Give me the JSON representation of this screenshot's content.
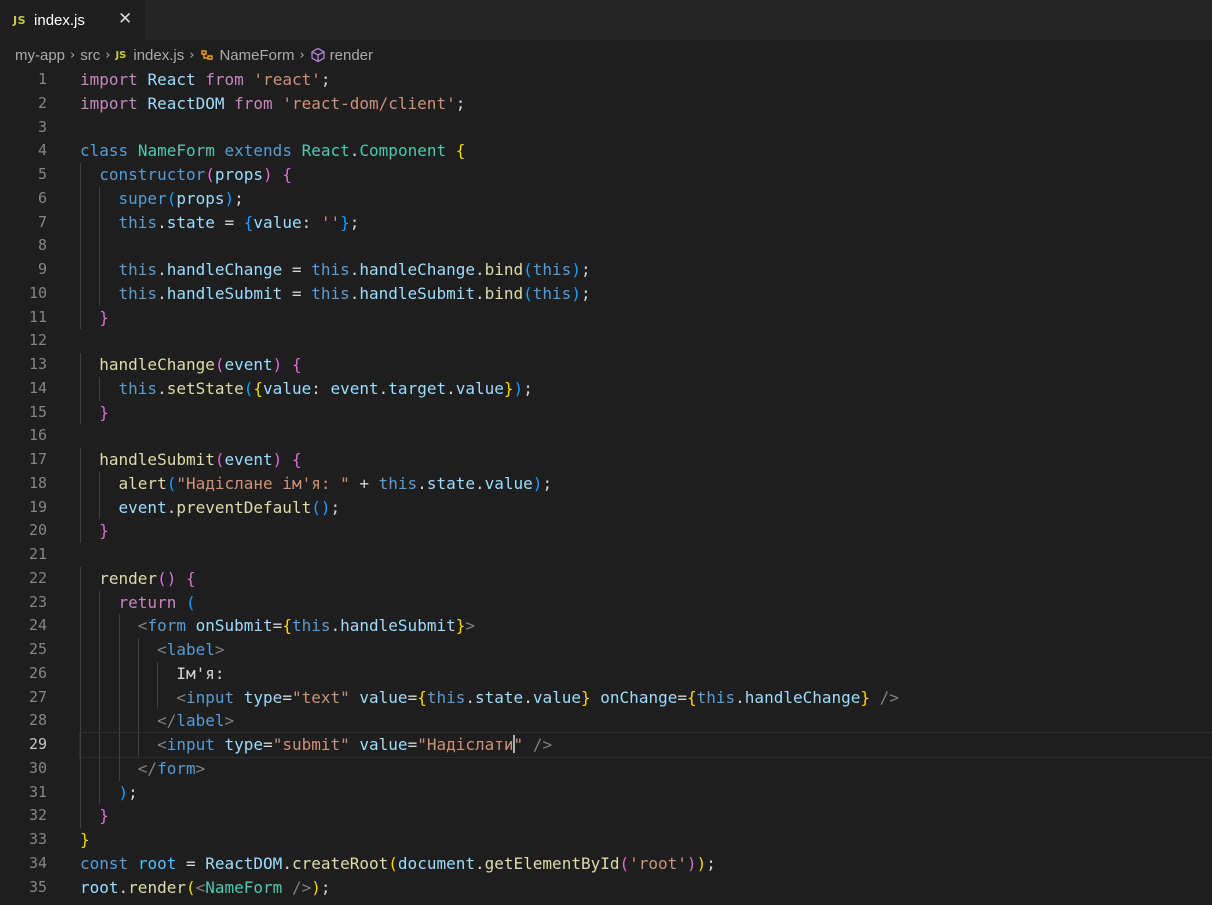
{
  "tab": {
    "badge": "JS",
    "title": "index.js",
    "close": "✕"
  },
  "breadcrumb": {
    "items": [
      "my-app",
      "src",
      "index.js",
      "NameForm",
      "render"
    ],
    "js_badge": "JS"
  },
  "editor": {
    "language": "javascript",
    "current_line": 29,
    "line_numbers": [
      "1",
      "2",
      "3",
      "4",
      "5",
      "6",
      "7",
      "8",
      "9",
      "10",
      "11",
      "12",
      "13",
      "14",
      "15",
      "16",
      "17",
      "18",
      "19",
      "20",
      "21",
      "22",
      "23",
      "24",
      "25",
      "26",
      "27",
      "28",
      "29",
      "30",
      "31",
      "32",
      "33",
      "34",
      "35"
    ],
    "lines": [
      [
        [
          "kc",
          "import"
        ],
        [
          "pl",
          " "
        ],
        [
          "var",
          "React"
        ],
        [
          "pl",
          " "
        ],
        [
          "kc",
          "from"
        ],
        [
          "pl",
          " "
        ],
        [
          "str",
          "'react'"
        ],
        [
          "pl",
          ";"
        ]
      ],
      [
        [
          "kc",
          "import"
        ],
        [
          "pl",
          " "
        ],
        [
          "var",
          "ReactDOM"
        ],
        [
          "pl",
          " "
        ],
        [
          "kc",
          "from"
        ],
        [
          "pl",
          " "
        ],
        [
          "str",
          "'react-dom/client'"
        ],
        [
          "pl",
          ";"
        ]
      ],
      [],
      [
        [
          "kw",
          "class"
        ],
        [
          "pl",
          " "
        ],
        [
          "cls",
          "NameForm"
        ],
        [
          "pl",
          " "
        ],
        [
          "kw",
          "extends"
        ],
        [
          "pl",
          " "
        ],
        [
          "cls",
          "React"
        ],
        [
          "pl",
          "."
        ],
        [
          "cls",
          "Component"
        ],
        [
          "pl",
          " "
        ],
        [
          "b1",
          "{"
        ]
      ],
      [
        [
          "pl",
          "  "
        ],
        [
          "kw",
          "constructor"
        ],
        [
          "b2",
          "("
        ],
        [
          "var",
          "props"
        ],
        [
          "b2",
          ")"
        ],
        [
          "pl",
          " "
        ],
        [
          "b2",
          "{"
        ]
      ],
      [
        [
          "pl",
          "    "
        ],
        [
          "kw",
          "super"
        ],
        [
          "b3",
          "("
        ],
        [
          "var",
          "props"
        ],
        [
          "b3",
          ")"
        ],
        [
          "pl",
          ";"
        ]
      ],
      [
        [
          "pl",
          "    "
        ],
        [
          "kw",
          "this"
        ],
        [
          "pl",
          "."
        ],
        [
          "var",
          "state"
        ],
        [
          "pl",
          " = "
        ],
        [
          "b3",
          "{"
        ],
        [
          "var",
          "value"
        ],
        [
          "pl",
          ": "
        ],
        [
          "str",
          "''"
        ],
        [
          "b3",
          "}"
        ],
        [
          "pl",
          ";"
        ]
      ],
      [],
      [
        [
          "pl",
          "    "
        ],
        [
          "kw",
          "this"
        ],
        [
          "pl",
          "."
        ],
        [
          "var",
          "handleChange"
        ],
        [
          "pl",
          " = "
        ],
        [
          "kw",
          "this"
        ],
        [
          "pl",
          "."
        ],
        [
          "var",
          "handleChange"
        ],
        [
          "pl",
          "."
        ],
        [
          "fn",
          "bind"
        ],
        [
          "b3",
          "("
        ],
        [
          "kw",
          "this"
        ],
        [
          "b3",
          ")"
        ],
        [
          "pl",
          ";"
        ]
      ],
      [
        [
          "pl",
          "    "
        ],
        [
          "kw",
          "this"
        ],
        [
          "pl",
          "."
        ],
        [
          "var",
          "handleSubmit"
        ],
        [
          "pl",
          " = "
        ],
        [
          "kw",
          "this"
        ],
        [
          "pl",
          "."
        ],
        [
          "var",
          "handleSubmit"
        ],
        [
          "pl",
          "."
        ],
        [
          "fn",
          "bind"
        ],
        [
          "b3",
          "("
        ],
        [
          "kw",
          "this"
        ],
        [
          "b3",
          ")"
        ],
        [
          "pl",
          ";"
        ]
      ],
      [
        [
          "pl",
          "  "
        ],
        [
          "b2",
          "}"
        ]
      ],
      [],
      [
        [
          "pl",
          "  "
        ],
        [
          "fn",
          "handleChange"
        ],
        [
          "b2",
          "("
        ],
        [
          "var",
          "event"
        ],
        [
          "b2",
          ")"
        ],
        [
          "pl",
          " "
        ],
        [
          "b2",
          "{"
        ]
      ],
      [
        [
          "pl",
          "    "
        ],
        [
          "kw",
          "this"
        ],
        [
          "pl",
          "."
        ],
        [
          "fn",
          "setState"
        ],
        [
          "b3",
          "("
        ],
        [
          "b1",
          "{"
        ],
        [
          "var",
          "value"
        ],
        [
          "pl",
          ": "
        ],
        [
          "var",
          "event"
        ],
        [
          "pl",
          "."
        ],
        [
          "var",
          "target"
        ],
        [
          "pl",
          "."
        ],
        [
          "var",
          "value"
        ],
        [
          "b1",
          "}"
        ],
        [
          "b3",
          ")"
        ],
        [
          "pl",
          ";"
        ]
      ],
      [
        [
          "pl",
          "  "
        ],
        [
          "b2",
          "}"
        ]
      ],
      [],
      [
        [
          "pl",
          "  "
        ],
        [
          "fn",
          "handleSubmit"
        ],
        [
          "b2",
          "("
        ],
        [
          "var",
          "event"
        ],
        [
          "b2",
          ")"
        ],
        [
          "pl",
          " "
        ],
        [
          "b2",
          "{"
        ]
      ],
      [
        [
          "pl",
          "    "
        ],
        [
          "fn",
          "alert"
        ],
        [
          "b3",
          "("
        ],
        [
          "str",
          "\"Надіслане ім'я: \""
        ],
        [
          "pl",
          " + "
        ],
        [
          "kw",
          "this"
        ],
        [
          "pl",
          "."
        ],
        [
          "var",
          "state"
        ],
        [
          "pl",
          "."
        ],
        [
          "var",
          "value"
        ],
        [
          "b3",
          ")"
        ],
        [
          "pl",
          ";"
        ]
      ],
      [
        [
          "pl",
          "    "
        ],
        [
          "var",
          "event"
        ],
        [
          "pl",
          "."
        ],
        [
          "fn",
          "preventDefault"
        ],
        [
          "b3",
          "("
        ],
        [
          "b3",
          ")"
        ],
        [
          "pl",
          ";"
        ]
      ],
      [
        [
          "pl",
          "  "
        ],
        [
          "b2",
          "}"
        ]
      ],
      [],
      [
        [
          "pl",
          "  "
        ],
        [
          "fn",
          "render"
        ],
        [
          "b2",
          "("
        ],
        [
          "b2",
          ")"
        ],
        [
          "pl",
          " "
        ],
        [
          "b2",
          "{"
        ]
      ],
      [
        [
          "pl",
          "    "
        ],
        [
          "kc",
          "return"
        ],
        [
          "pl",
          " "
        ],
        [
          "b3",
          "("
        ]
      ],
      [
        [
          "pl",
          "      "
        ],
        [
          "tb",
          "<"
        ],
        [
          "tag",
          "form"
        ],
        [
          "pl",
          " "
        ],
        [
          "var",
          "onSubmit"
        ],
        [
          "pl",
          "="
        ],
        [
          "b1",
          "{"
        ],
        [
          "kw",
          "this"
        ],
        [
          "pl",
          "."
        ],
        [
          "var",
          "handleSubmit"
        ],
        [
          "b1",
          "}"
        ],
        [
          "tb",
          ">"
        ]
      ],
      [
        [
          "pl",
          "        "
        ],
        [
          "tb",
          "<"
        ],
        [
          "tag",
          "label"
        ],
        [
          "tb",
          ">"
        ]
      ],
      [
        [
          "pl",
          "          Ім'я:"
        ]
      ],
      [
        [
          "pl",
          "          "
        ],
        [
          "tb",
          "<"
        ],
        [
          "tag",
          "input"
        ],
        [
          "pl",
          " "
        ],
        [
          "var",
          "type"
        ],
        [
          "pl",
          "="
        ],
        [
          "str",
          "\"text\""
        ],
        [
          "pl",
          " "
        ],
        [
          "var",
          "value"
        ],
        [
          "pl",
          "="
        ],
        [
          "b1",
          "{"
        ],
        [
          "kw",
          "this"
        ],
        [
          "pl",
          "."
        ],
        [
          "var",
          "state"
        ],
        [
          "pl",
          "."
        ],
        [
          "var",
          "value"
        ],
        [
          "b1",
          "}"
        ],
        [
          "pl",
          " "
        ],
        [
          "var",
          "onChange"
        ],
        [
          "pl",
          "="
        ],
        [
          "b1",
          "{"
        ],
        [
          "kw",
          "this"
        ],
        [
          "pl",
          "."
        ],
        [
          "var",
          "handleChange"
        ],
        [
          "b1",
          "}"
        ],
        [
          "pl",
          " "
        ],
        [
          "tb",
          "/>"
        ]
      ],
      [
        [
          "pl",
          "        "
        ],
        [
          "tb",
          "</"
        ],
        [
          "tag",
          "label"
        ],
        [
          "tb",
          ">"
        ]
      ],
      [
        [
          "pl",
          "        "
        ],
        [
          "tb",
          "<"
        ],
        [
          "tag",
          "input"
        ],
        [
          "pl",
          " "
        ],
        [
          "var",
          "type"
        ],
        [
          "pl",
          "="
        ],
        [
          "str",
          "\"submit\""
        ],
        [
          "pl",
          " "
        ],
        [
          "var",
          "value"
        ],
        [
          "pl",
          "="
        ],
        [
          "str",
          "\"Надіслати"
        ],
        [
          "cursor",
          ""
        ],
        [
          "str",
          "\""
        ],
        [
          "pl",
          " "
        ],
        [
          "tb",
          "/>"
        ]
      ],
      [
        [
          "pl",
          "      "
        ],
        [
          "tb",
          "</"
        ],
        [
          "tag",
          "form"
        ],
        [
          "tb",
          ">"
        ]
      ],
      [
        [
          "pl",
          "    "
        ],
        [
          "b3",
          ")"
        ],
        [
          "pl",
          ";"
        ]
      ],
      [
        [
          "pl",
          "  "
        ],
        [
          "b2",
          "}"
        ]
      ],
      [
        [
          "b1",
          "}"
        ]
      ],
      [
        [
          "kw",
          "const"
        ],
        [
          "pl",
          " "
        ],
        [
          "cst",
          "root"
        ],
        [
          "pl",
          " = "
        ],
        [
          "var",
          "ReactDOM"
        ],
        [
          "pl",
          "."
        ],
        [
          "fn",
          "createRoot"
        ],
        [
          "b1",
          "("
        ],
        [
          "var",
          "document"
        ],
        [
          "pl",
          "."
        ],
        [
          "fn",
          "getElementById"
        ],
        [
          "b2",
          "("
        ],
        [
          "str",
          "'root'"
        ],
        [
          "b2",
          ")"
        ],
        [
          "b1",
          ")"
        ],
        [
          "pl",
          ";"
        ]
      ],
      [
        [
          "var",
          "root"
        ],
        [
          "pl",
          "."
        ],
        [
          "fn",
          "render"
        ],
        [
          "b1",
          "("
        ],
        [
          "tb",
          "<"
        ],
        [
          "cls",
          "NameForm"
        ],
        [
          "pl",
          " "
        ],
        [
          "tb",
          "/>"
        ],
        [
          "b1",
          ")"
        ],
        [
          "pl",
          ";"
        ]
      ]
    ]
  }
}
